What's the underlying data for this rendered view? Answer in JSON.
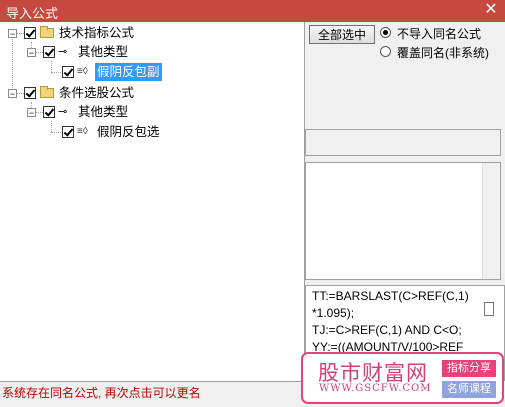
{
  "window": {
    "title": "导入公式",
    "close_glyph": "✕",
    "accent_color": "#c44a3f"
  },
  "tree": {
    "groups": [
      {
        "label": "技术指标公式",
        "children": [
          {
            "label": "其他类型",
            "children": [
              {
                "label": "假阴反包副",
                "selected": true
              }
            ]
          }
        ]
      },
      {
        "label": "条件选股公式",
        "children": [
          {
            "label": "其他类型",
            "children": [
              {
                "label": "假阴反包选",
                "selected": false
              }
            ]
          }
        ]
      }
    ]
  },
  "options": {
    "select_all_label": "全部选中",
    "radio_skip_label": "不导入同名公式",
    "radio_overwrite_label": "覆盖同名(非系统)",
    "selected_radio": "skip"
  },
  "code": {
    "lines": [
      "TT:=BARSLAST(C>REF(C,1)",
      "*1.095);",
      "TJ:=C>REF(C,1) AND C<O;",
      "YY:=((AMOUNT/V/100>REF"
    ]
  },
  "status": {
    "message": "系统存在同名公式, 再次点击可以更名",
    "color": "#c00000"
  },
  "watermark": {
    "site_name": "股市财富网",
    "url": "WWW.GSCFW.COM",
    "tag1": "指标分享",
    "tag2": "名师课程",
    "tag1_color": "#e8427a",
    "tag2_color": "#8fa3dc"
  }
}
